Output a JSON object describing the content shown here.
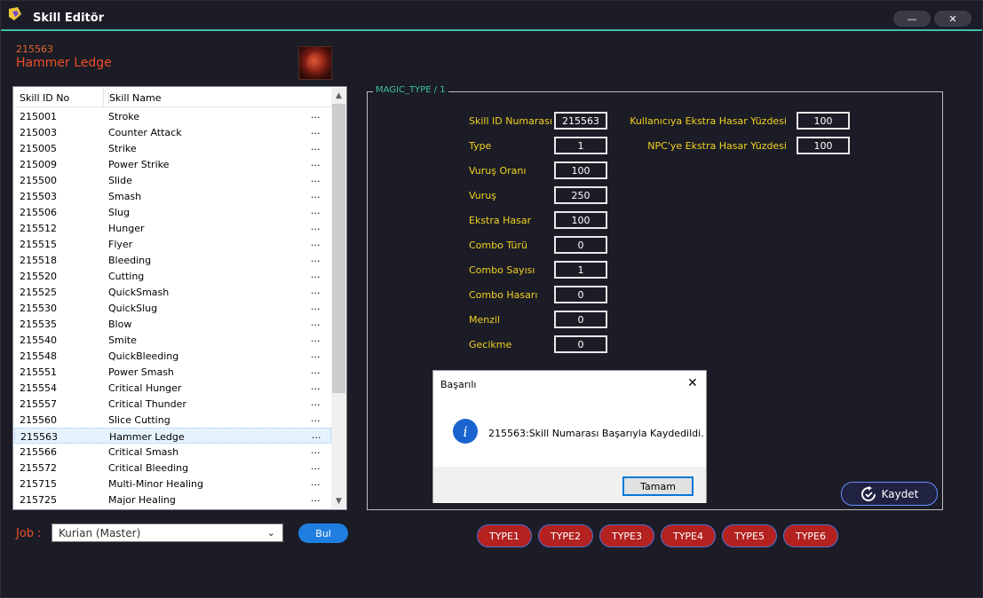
{
  "window": {
    "title": "Skill Editör",
    "minimize_glyph": "—",
    "close_glyph": "✕"
  },
  "header": {
    "skill_id": "215563",
    "skill_name": "Hammer Ledge"
  },
  "list": {
    "columns": [
      "Skill ID No",
      "Skill Name"
    ],
    "rows": [
      {
        "id": "215001",
        "name": "Stroke",
        "more": "..."
      },
      {
        "id": "215003",
        "name": "Counter Attack",
        "more": "..."
      },
      {
        "id": "215005",
        "name": "Strike",
        "more": "..."
      },
      {
        "id": "215009",
        "name": "Power Strike",
        "more": "..."
      },
      {
        "id": "215500",
        "name": "Slide",
        "more": "..."
      },
      {
        "id": "215503",
        "name": "Smash",
        "more": "..."
      },
      {
        "id": "215506",
        "name": "Slug",
        "more": "..."
      },
      {
        "id": "215512",
        "name": "Hunger",
        "more": "..."
      },
      {
        "id": "215515",
        "name": "Flyer",
        "more": "..."
      },
      {
        "id": "215518",
        "name": "Bleeding",
        "more": "..."
      },
      {
        "id": "215520",
        "name": "Cutting",
        "more": "..."
      },
      {
        "id": "215525",
        "name": "QuickSmash",
        "more": "..."
      },
      {
        "id": "215530",
        "name": "QuickSlug",
        "more": "..."
      },
      {
        "id": "215535",
        "name": "Blow",
        "more": "..."
      },
      {
        "id": "215540",
        "name": "Smite",
        "more": "..."
      },
      {
        "id": "215548",
        "name": "QuickBleeding",
        "more": "..."
      },
      {
        "id": "215551",
        "name": "Power Smash",
        "more": "..."
      },
      {
        "id": "215554",
        "name": "Critical Hunger",
        "more": "..."
      },
      {
        "id": "215557",
        "name": "Critical Thunder",
        "more": "..."
      },
      {
        "id": "215560",
        "name": "Slice Cutting",
        "more": "..."
      },
      {
        "id": "215563",
        "name": "Hammer Ledge",
        "more": "...",
        "selected": true
      },
      {
        "id": "215566",
        "name": "Critical Smash",
        "more": "..."
      },
      {
        "id": "215572",
        "name": "Critical Bleeding",
        "more": "..."
      },
      {
        "id": "215715",
        "name": "Multi-Minor Healing",
        "more": "..."
      },
      {
        "id": "215725",
        "name": "Major Healing",
        "more": "..."
      }
    ]
  },
  "job": {
    "label": "Job :",
    "value": "Kurian (Master)",
    "search_label": "Bul"
  },
  "details": {
    "group_title": "MAGIC_TYPE / 1",
    "left_fields": [
      {
        "label": "Skill ID Numarası",
        "value": "215563"
      },
      {
        "label": "Type",
        "value": "1"
      },
      {
        "label": "Vuruş Oranı",
        "value": "100"
      },
      {
        "label": "Vuruş",
        "value": "250"
      },
      {
        "label": "Ekstra Hasar",
        "value": "100"
      },
      {
        "label": "Combo Türü",
        "value": "0"
      },
      {
        "label": "Combo Sayısı",
        "value": "1"
      },
      {
        "label": "Combo Hasarı",
        "value": "0"
      },
      {
        "label": "Menzil",
        "value": "0"
      },
      {
        "label": "Gecikme",
        "value": "0"
      }
    ],
    "right_fields": [
      {
        "label": "Kullanıcıya Ekstra Hasar Yüzdesi",
        "value": "100"
      },
      {
        "label": "NPC'ye Ekstra Hasar Yüzdesi",
        "value": "100"
      }
    ],
    "save_label": "Kaydet"
  },
  "type_buttons": [
    "TYPE1",
    "TYPE2",
    "TYPE3",
    "TYPE4",
    "TYPE5",
    "TYPE6"
  ],
  "dialog": {
    "title": "Başarılı",
    "icon": "i",
    "message": "215563:Skill Numarası Başarıyla Kaydedildi.",
    "ok_label": "Tamam"
  }
}
